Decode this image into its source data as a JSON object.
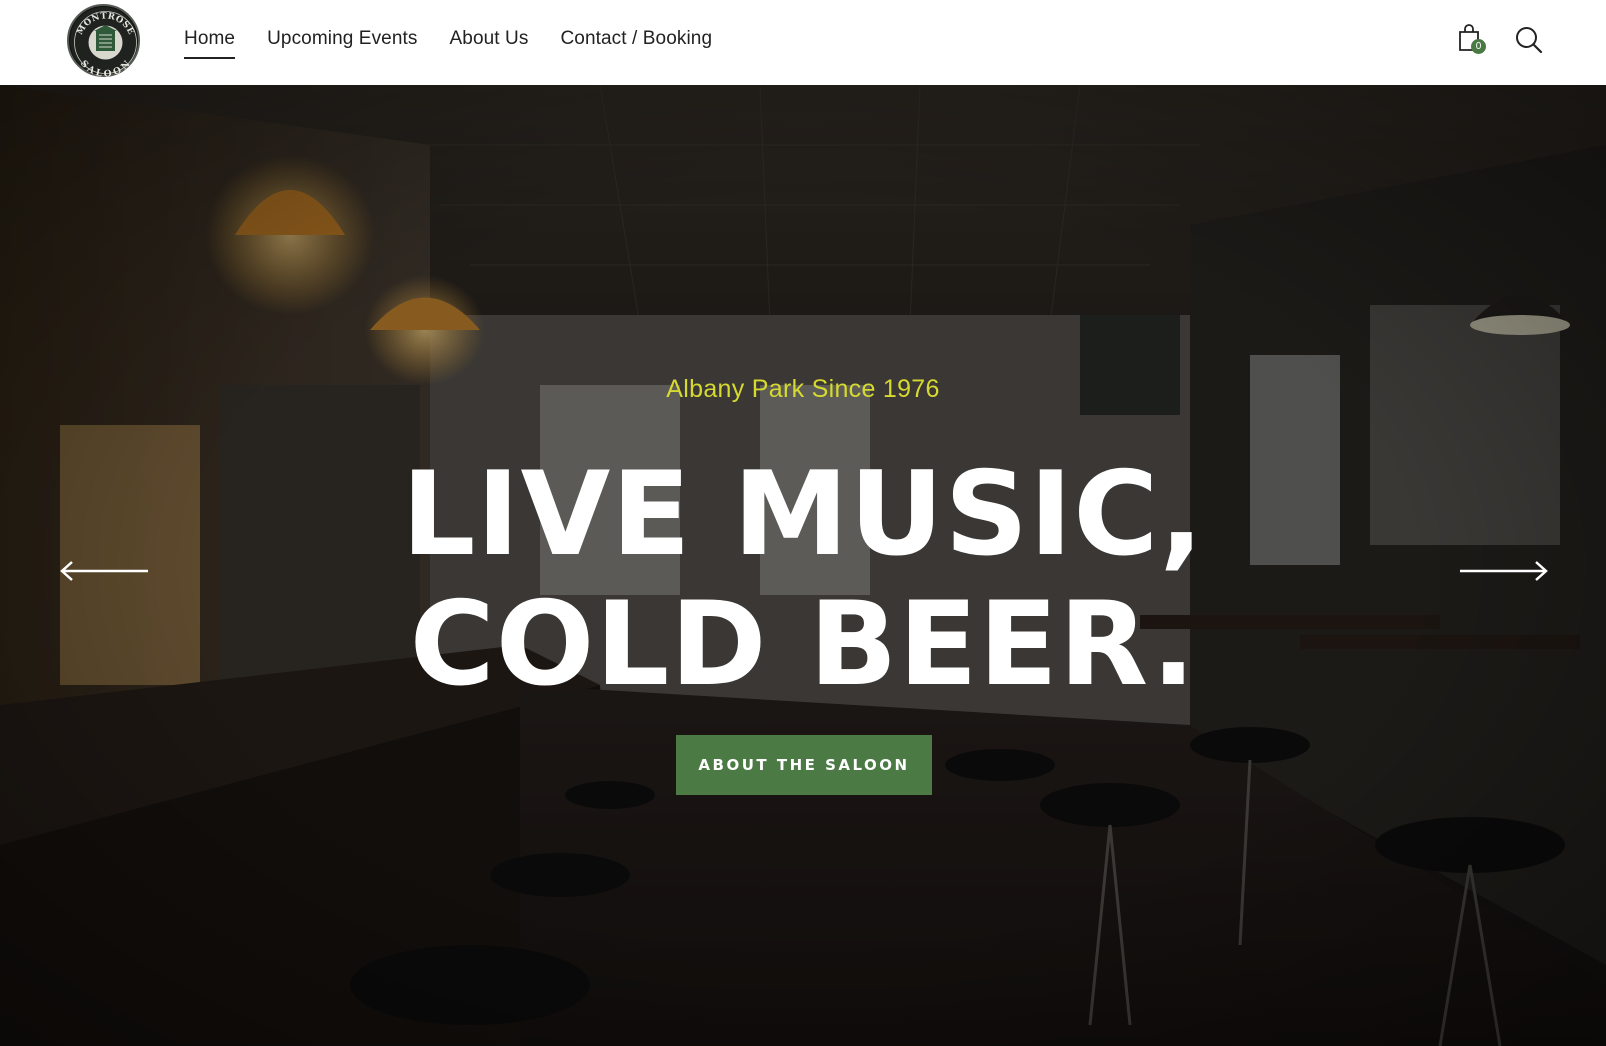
{
  "header": {
    "logo": {
      "top_text": "MONTROSE",
      "bottom_text": "SALOON",
      "icon": "saloon-building-emblem"
    },
    "nav": [
      {
        "label": "Home",
        "active": true
      },
      {
        "label": "Upcoming Events",
        "active": false
      },
      {
        "label": "About Us",
        "active": false
      },
      {
        "label": "Contact / Booking",
        "active": false
      }
    ],
    "cart": {
      "icon": "shopping-bag-icon",
      "count": "0"
    },
    "search": {
      "icon": "search-icon"
    }
  },
  "hero": {
    "tagline": "Albany Park Since 1976",
    "headline_line1": "LIVE MUSIC,",
    "headline_line2": "COLD BEER.",
    "cta_label": "ABOUT THE SALOON",
    "prev_icon": "arrow-left-icon",
    "next_icon": "arrow-right-icon"
  },
  "colors": {
    "accent_green": "#4b7a45",
    "tagline_yellow": "#d6d930",
    "text_dark": "#222222",
    "hero_text": "#ffffff"
  }
}
